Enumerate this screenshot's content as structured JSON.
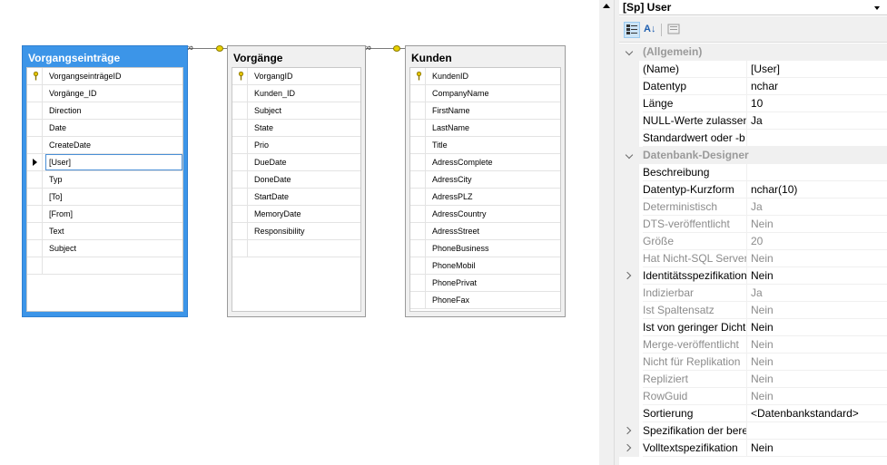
{
  "diagram": {
    "tables": [
      {
        "title": "Vorgangseinträge",
        "rows": [
          "VorgangseinträgeID",
          "Vorgänge_ID",
          "Direction",
          "Date",
          "CreateDate",
          "[User]",
          "Typ",
          "[To]",
          "[From]",
          "Text",
          "Subject"
        ]
      },
      {
        "title": "Vorgänge",
        "rows": [
          "VorgangID",
          "Kunden_ID",
          "Subject",
          "State",
          "Prio",
          "DueDate",
          "DoneDate",
          "StartDate",
          "MemoryDate",
          "Responsibility"
        ]
      },
      {
        "title": "Kunden",
        "rows": [
          "KundenID",
          "CompanyName",
          "FirstName",
          "LastName",
          "Title",
          "AdressComplete",
          "AdressCity",
          "AdressPLZ",
          "AdressCountry",
          "AdressStreet",
          "PhoneBusiness",
          "PhoneMobil",
          "PhonePrivat",
          "PhoneFax"
        ]
      }
    ],
    "relation_end_symbol": "∞"
  },
  "properties": {
    "object": "[Sp] User",
    "toolbar": {
      "categorized_icon": "categorized-icon",
      "alphabetical_icon": "alphabetical-icon",
      "property_pages_icon": "property-pages-icon",
      "alphabetical_glyph": "A↓"
    },
    "rows": [
      {
        "name": "(Allgemein)",
        "value": "",
        "category": true
      },
      {
        "name": "(Name)",
        "value": "[User]"
      },
      {
        "name": "Datentyp",
        "value": "nchar"
      },
      {
        "name": "Länge",
        "value": "10"
      },
      {
        "name": "NULL-Werte zulassen",
        "value": "Ja"
      },
      {
        "name": "Standardwert oder -b",
        "value": ""
      },
      {
        "name": "Datenbank-Designer",
        "value": "",
        "category": true
      },
      {
        "name": "Beschreibung",
        "value": ""
      },
      {
        "name": "Datentyp-Kurzform",
        "value": "nchar(10)"
      },
      {
        "name": "Deterministisch",
        "value": "Ja",
        "dim": true
      },
      {
        "name": "DTS-veröffentlicht",
        "value": "Nein",
        "dim": true
      },
      {
        "name": "Größe",
        "value": "20",
        "dim": true
      },
      {
        "name": "Hat Nicht-SQL Server",
        "value": "Nein",
        "dim": true
      },
      {
        "name": "Identitätsspezifikation",
        "value": "Nein",
        "expandable": true
      },
      {
        "name": "Indizierbar",
        "value": "Ja",
        "dim": true
      },
      {
        "name": "Ist Spaltensatz",
        "value": "Nein",
        "dim": true
      },
      {
        "name": "Ist von geringer Dichte",
        "value": "Nein"
      },
      {
        "name": "Merge-veröffentlicht",
        "value": "Nein",
        "dim": true
      },
      {
        "name": "Nicht für Replikation",
        "value": "Nein",
        "dim": true
      },
      {
        "name": "Repliziert",
        "value": "Nein",
        "dim": true
      },
      {
        "name": "RowGuid",
        "value": "Nein",
        "dim": true
      },
      {
        "name": "Sortierung",
        "value": "<Datenbankstandard>"
      },
      {
        "name": "Spezifikation der bere",
        "value": "",
        "expandable": true
      },
      {
        "name": "Volltextspezifikation",
        "value": "Nein",
        "expandable": true
      }
    ]
  }
}
